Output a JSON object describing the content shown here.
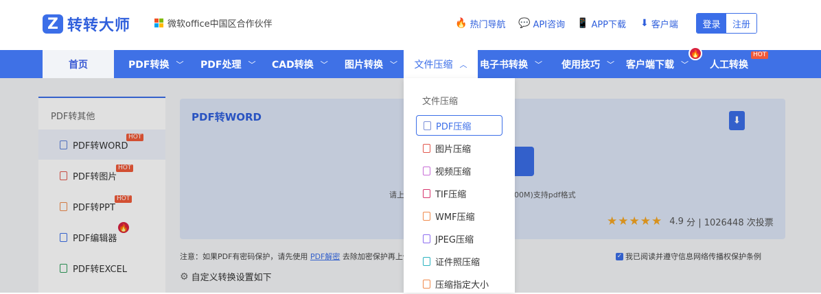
{
  "header": {
    "logo_mark": "Z",
    "logo_text": "转转大师",
    "partner_text": "微软office中国区合作伙伴",
    "ms_colors": [
      "#f25022",
      "#7fba00",
      "#00a4ef",
      "#ffb900"
    ],
    "links": [
      {
        "icon": "fire-icon",
        "glyph": "🔥",
        "label": "热门导航"
      },
      {
        "icon": "chat-icon",
        "glyph": "💬",
        "label": "API咨询"
      },
      {
        "icon": "phone-icon",
        "glyph": "📱",
        "label": "APP下载"
      },
      {
        "icon": "download-icon",
        "glyph": "⬇",
        "label": "客户端"
      }
    ],
    "login": "登录",
    "register": "注册"
  },
  "nav": {
    "home": "首页",
    "items": [
      {
        "label": "PDF转换",
        "chevron": "﹀"
      },
      {
        "label": "PDF处理",
        "chevron": "﹀"
      },
      {
        "label": "CAD转换",
        "chevron": "﹀"
      },
      {
        "label": "图片转换",
        "chevron": "﹀"
      },
      {
        "label": "文件压缩",
        "chevron": "︿"
      },
      {
        "label": "电子书转换",
        "chevron": "﹀"
      },
      {
        "label": "使用技巧",
        "chevron": "﹀"
      },
      {
        "label": "客户端下载",
        "chevron": "﹀"
      },
      {
        "label": "人工转换",
        "chevron": ""
      }
    ],
    "hot": "HOT",
    "fire": "🔥"
  },
  "dropdown": {
    "title": "文件压缩",
    "items": [
      {
        "label": "PDF压缩",
        "color": "#7b8fd8"
      },
      {
        "label": "图片压缩",
        "color": "#e2574c"
      },
      {
        "label": "视频压缩",
        "color": "#c86dd7"
      },
      {
        "label": "TIF压缩",
        "color": "#d6336c"
      },
      {
        "label": "WMF压缩",
        "color": "#f08a4b"
      },
      {
        "label": "JPEG压缩",
        "color": "#8c6cf0"
      },
      {
        "label": "证件照压缩",
        "color": "#2bb3c0"
      },
      {
        "label": "压缩指定大小",
        "color": "#f08a4b"
      }
    ]
  },
  "sidebar": {
    "title": "PDF转其他",
    "items": [
      {
        "label": "PDF转WORD",
        "badge": "HOT",
        "color": "#5b7fd6"
      },
      {
        "label": "PDF转图片",
        "badge": "HOT",
        "color": "#e2574c"
      },
      {
        "label": "PDF转PPT",
        "badge": "HOT",
        "color": "#f08a4b"
      },
      {
        "label": "PDF编辑器",
        "badge": "🔥",
        "color": "#3b6ee8"
      },
      {
        "label": "PDF转EXCEL",
        "badge": "",
        "color": "#2e9e5b"
      }
    ]
  },
  "panel": {
    "title": "PDF转WORD",
    "hint_left": "请上",
    "hint_right": "00M)支持pdf格式",
    "stars": "★★★★★",
    "score": "4.9",
    "score_unit": "分",
    "votes": "| 1026448 次投票"
  },
  "note": {
    "prefix": "注意：如果PDF有密码保护，请先使用",
    "link": "PDF解密",
    "suffix": "去除加密保护再上传"
  },
  "agree_text": "我已阅读并遵守信息网络传播权保护条例",
  "custom_settings": "自定义转换设置如下"
}
